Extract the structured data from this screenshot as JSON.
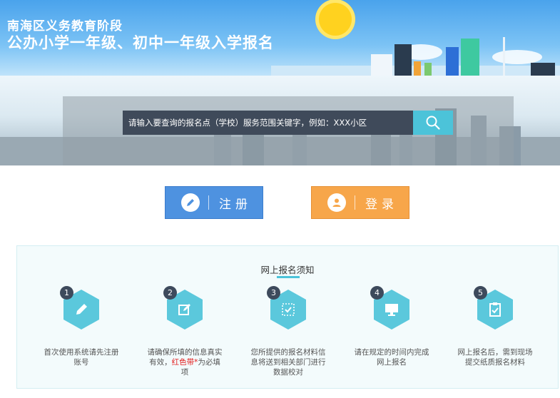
{
  "header": {
    "line1": "南海区义务教育阶段",
    "line2": "公办小学一年级、初中一年级入学报名"
  },
  "search": {
    "placeholder": "请输入要查询的报名点（学校）服务范围关键字，例如：XXX小区",
    "button_icon": "search-icon"
  },
  "buttons": {
    "register": {
      "label": "注册",
      "icon": "pencil-icon",
      "color": "#4e92e0"
    },
    "login": {
      "label": "登录",
      "icon": "user-icon",
      "color": "#f7a64a"
    }
  },
  "notice": {
    "title": "网上报名须知",
    "steps": [
      {
        "num": "1",
        "icon": "pencil-icon",
        "text": "首次使用系统请先注册账号"
      },
      {
        "num": "2",
        "icon": "edit-icon",
        "text_a": "请确保所填的信息真实有效，",
        "text_red": "红色带*",
        "text_b": "为必填项"
      },
      {
        "num": "3",
        "icon": "checkbox-icon",
        "text": "您所提供的报名材料信息将送到相关部门进行数据校对"
      },
      {
        "num": "4",
        "icon": "monitor-icon",
        "text": "请在规定的时间内完成网上报名"
      },
      {
        "num": "5",
        "icon": "clipboard-icon",
        "text": "网上报名后，需到现场提交纸质报名材料"
      }
    ]
  },
  "colors": {
    "accent": "#4cc3d9",
    "hex_fill": "#5bc8dc"
  }
}
